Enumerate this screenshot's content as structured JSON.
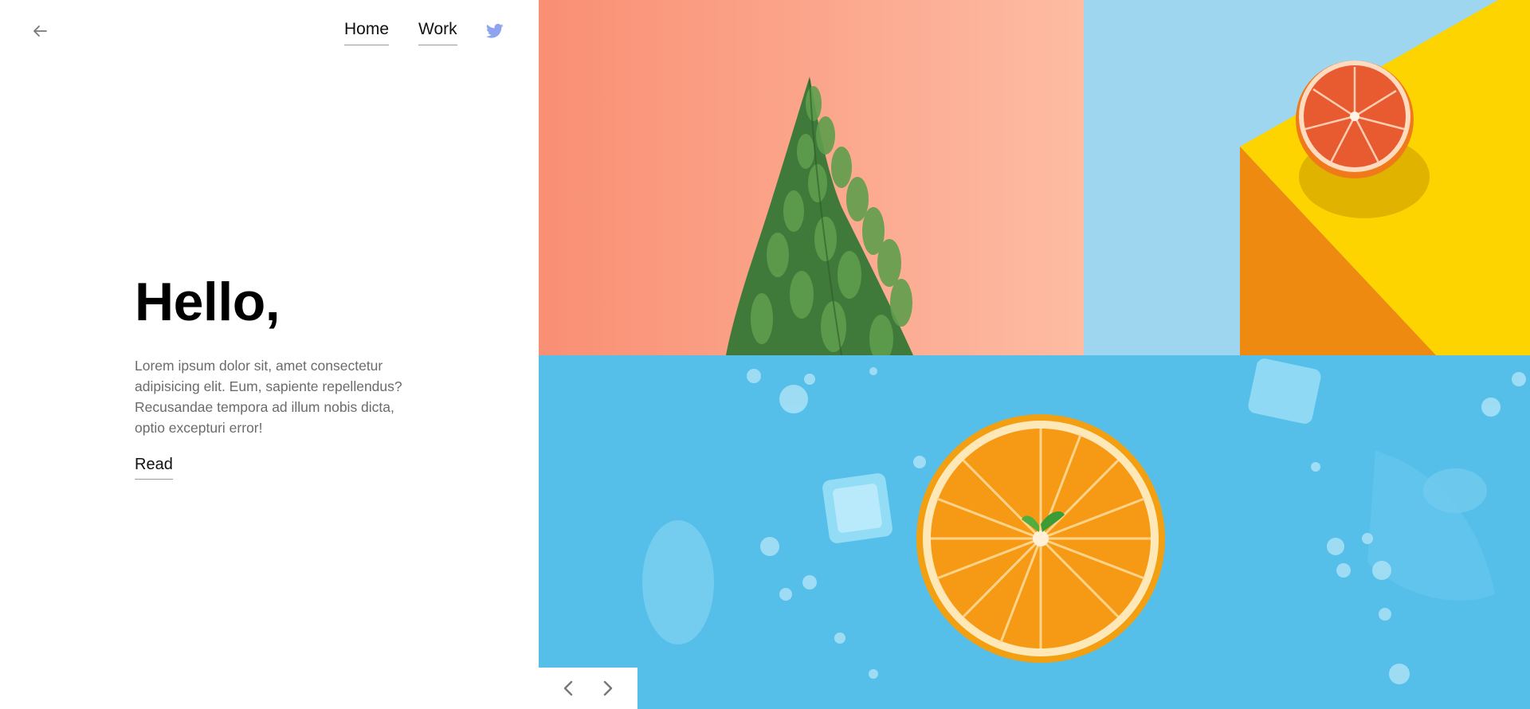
{
  "nav": {
    "back_icon": "arrow-left-icon",
    "links": [
      {
        "label": "Home"
      },
      {
        "label": "Work"
      }
    ],
    "social_icon": "twitter-icon",
    "social_color": "#8fa4ee"
  },
  "hero": {
    "title": "Hello,",
    "text": "Lorem ipsum dolor sit, amet consectetur adipisicing elit. Eum, sapiente repellendus? Recusandae tempora ad illum nobis dicta, optio excepturi error!",
    "read_label": "Read"
  },
  "gallery": {
    "images": [
      {
        "subject": "pine branch on coral wall",
        "bg_color": "#fba98f"
      },
      {
        "subject": "grapefruit half on yellow block",
        "bg_color": "#9fd6ef"
      },
      {
        "subject": "orange slice with ice cubes on blue",
        "bg_color": "#55bfe9"
      }
    ],
    "prev_icon": "chevron-left-icon",
    "next_icon": "chevron-right-icon"
  },
  "colors": {
    "accent_underline": "#9a9a9a",
    "text_dark": "#111111",
    "text_muted": "#6b6b6b"
  }
}
